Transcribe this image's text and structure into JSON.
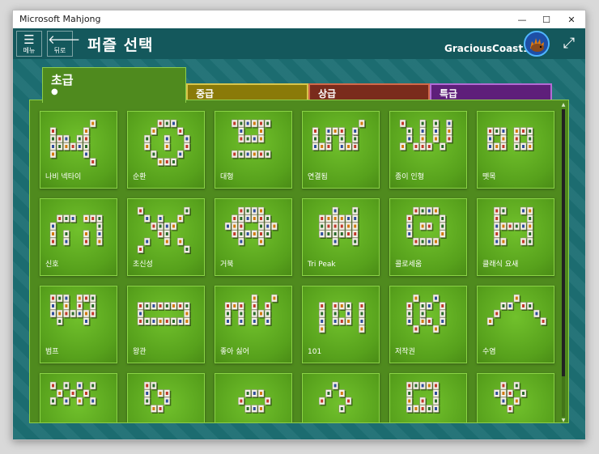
{
  "window": {
    "title": "Microsoft Mahjong",
    "minimize": "—",
    "maximize": "☐",
    "close": "✕"
  },
  "topbar": {
    "menu_label": "메뉴",
    "back_label": "뒤로",
    "page_title": "퍼즐 선택",
    "username": "GraciousCoast15"
  },
  "tabs": [
    {
      "name": "초급",
      "dots": "●"
    },
    {
      "name": "중급",
      "dots": "●●"
    },
    {
      "name": "상급",
      "dots": "●●●"
    },
    {
      "name": "특급",
      "dots": "●●●●"
    }
  ],
  "puzzles": [
    {
      "name": "나비 넥타이"
    },
    {
      "name": "순환"
    },
    {
      "name": "대형"
    },
    {
      "name": "연결됨"
    },
    {
      "name": "종이 인형"
    },
    {
      "name": "뗏목"
    },
    {
      "name": "신호"
    },
    {
      "name": "초신성"
    },
    {
      "name": "거북"
    },
    {
      "name": "Tri Peak"
    },
    {
      "name": "콜로세움"
    },
    {
      "name": "클래식 요새"
    },
    {
      "name": "범프"
    },
    {
      "name": "왕관"
    },
    {
      "name": "좋아 싫어"
    },
    {
      "name": "101"
    },
    {
      "name": "저작권"
    },
    {
      "name": "수염"
    },
    {
      "name": ""
    },
    {
      "name": ""
    },
    {
      "name": ""
    },
    {
      "name": ""
    },
    {
      "name": ""
    },
    {
      "name": ""
    }
  ],
  "colors": {
    "app_bg": "#1d6f74",
    "beginner": "#4f8a1e",
    "intermediate": "#8a7a09",
    "advanced": "#7a2b1c",
    "expert": "#5e1f7a"
  }
}
